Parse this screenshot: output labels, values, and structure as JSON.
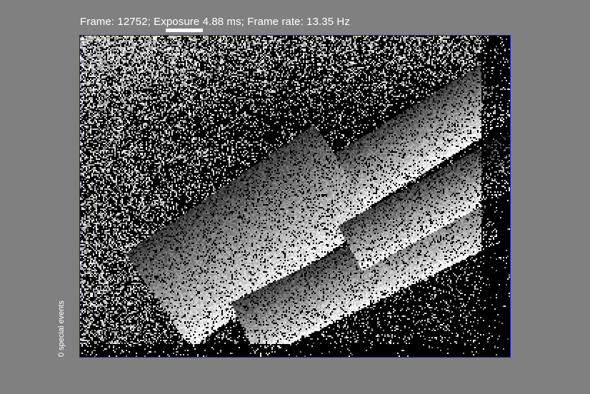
{
  "status": {
    "frame_label": "Frame:",
    "frame_number": "12752",
    "exposure_label": "Exposure",
    "exposure_value": "4.88 ms",
    "frame_rate_label": "Frame rate:",
    "frame_rate_value": "13.35 Hz"
  },
  "exposure_level": 0.25,
  "side_label": "0 special events",
  "colors": {
    "background": "#808080",
    "frame_border": "#1a1ad0",
    "text": "#ffffff"
  }
}
